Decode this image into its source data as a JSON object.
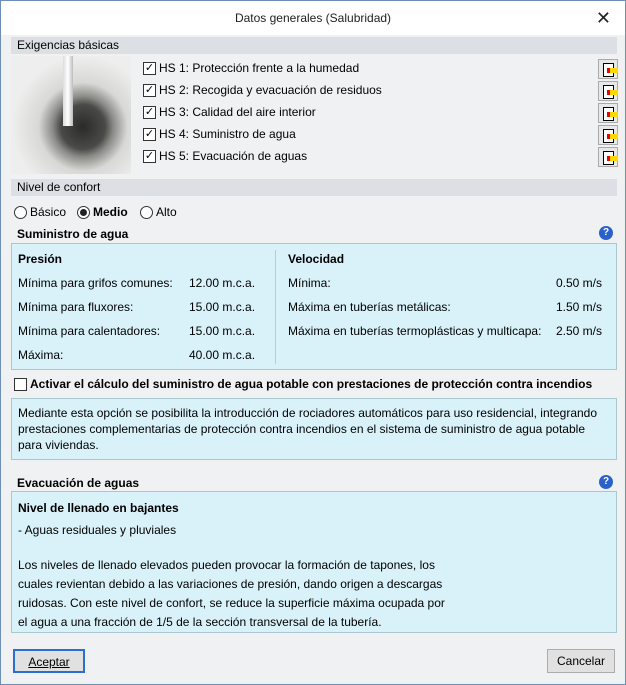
{
  "title": "Datos generales (Salubridad)",
  "exigencias": {
    "header": "Exigencias básicas",
    "items": [
      {
        "label": "HS 1: Protección frente a la humedad",
        "checked": true
      },
      {
        "label": "HS 2: Recogida y evacuación de residuos",
        "checked": true
      },
      {
        "label": "HS 3: Calidad del aire interior",
        "checked": true
      },
      {
        "label": "HS 4: Suministro de agua",
        "checked": true
      },
      {
        "label": "HS 5: Evacuación de aguas",
        "checked": true
      }
    ]
  },
  "confort": {
    "header": "Nivel de confort",
    "options": [
      "Básico",
      "Medio",
      "Alto"
    ],
    "selected": "Medio"
  },
  "suministro": {
    "title": "Suministro de agua",
    "presion": {
      "title": "Presión",
      "rows": [
        {
          "label": "Mínima para grifos comunes:",
          "value": "12.00 m.c.a."
        },
        {
          "label": "Mínima para fluxores:",
          "value": "15.00 m.c.a."
        },
        {
          "label": "Mínima para calentadores:",
          "value": "15.00 m.c.a."
        },
        {
          "label": "Máxima:",
          "value": "40.00 m.c.a."
        }
      ]
    },
    "velocidad": {
      "title": "Velocidad",
      "rows": [
        {
          "label": "Mínima:",
          "value": "0.50 m/s"
        },
        {
          "label": "Máxima en tuberías metálicas:",
          "value": "1.50 m/s"
        },
        {
          "label": "Máxima en tuberías termoplásticas y multicapa:",
          "value": "2.50 m/s"
        }
      ]
    }
  },
  "incendios": {
    "label": "Activar el cálculo del suministro de agua potable con prestaciones de protección contra incendios",
    "checked": false,
    "info": "Mediante esta opción se posibilita la introducción de rociadores automáticos para uso residencial, integrando prestaciones complementarias de protección contra incendios en el sistema de suministro de agua potable para viviendas."
  },
  "evacuacion": {
    "title": "Evacuación de aguas",
    "subtitle": "Nivel de llenado en bajantes",
    "type": "- Aguas residuales y pluviales",
    "text": "Los niveles de llenado elevados pueden provocar la formación de tapones, los cuales revientan debido a las variaciones de presión, dando origen a descargas ruidosas. Con este nivel de confort, se reduce la superficie máxima ocupada por el agua a una fracción de 1/5 de la sección transversal de la tubería."
  },
  "buttons": {
    "accept": "Aceptar",
    "cancel": "Cancelar"
  }
}
